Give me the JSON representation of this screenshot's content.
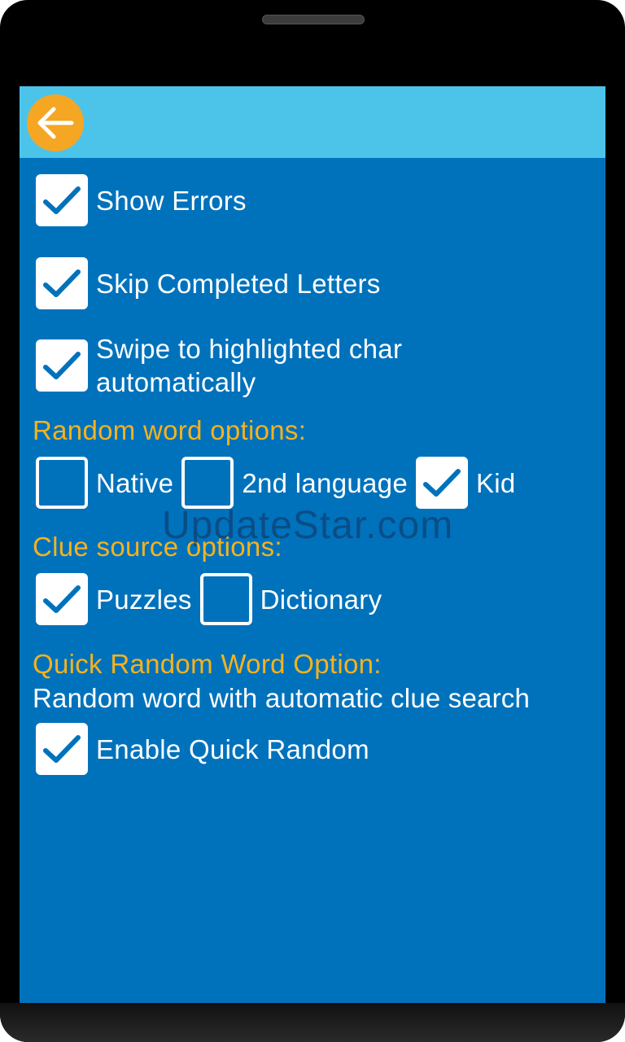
{
  "header": {
    "back_icon": "arrow-left-icon",
    "accent_color": "#f5a623",
    "bar_color": "#4cc4ea"
  },
  "settings": {
    "show_errors": {
      "label": "Show Errors",
      "checked": true
    },
    "skip_completed": {
      "label": "Skip Completed Letters",
      "checked": true
    },
    "swipe_line1": "Swipe to highlighted char",
    "swipe_line2": "automatically",
    "swipe_checked": true
  },
  "random_word": {
    "title": "Random word options:",
    "options": [
      {
        "label": "Native",
        "checked": false
      },
      {
        "label": "2nd language",
        "checked": false
      },
      {
        "label": "Kid",
        "checked": true
      }
    ]
  },
  "clue_source": {
    "title": "Clue source options:",
    "options": [
      {
        "label": "Puzzles",
        "checked": true
      },
      {
        "label": "Dictionary",
        "checked": false
      }
    ]
  },
  "quick_random": {
    "title": "Quick Random Word Option:",
    "description": "Random word with automatic clue search",
    "enable": {
      "label": "Enable Quick Random",
      "checked": true
    }
  },
  "watermark": "UpdateStar.com",
  "colors": {
    "background": "#0072bc",
    "section_title": "#f6b21e",
    "text": "#ffffff"
  }
}
